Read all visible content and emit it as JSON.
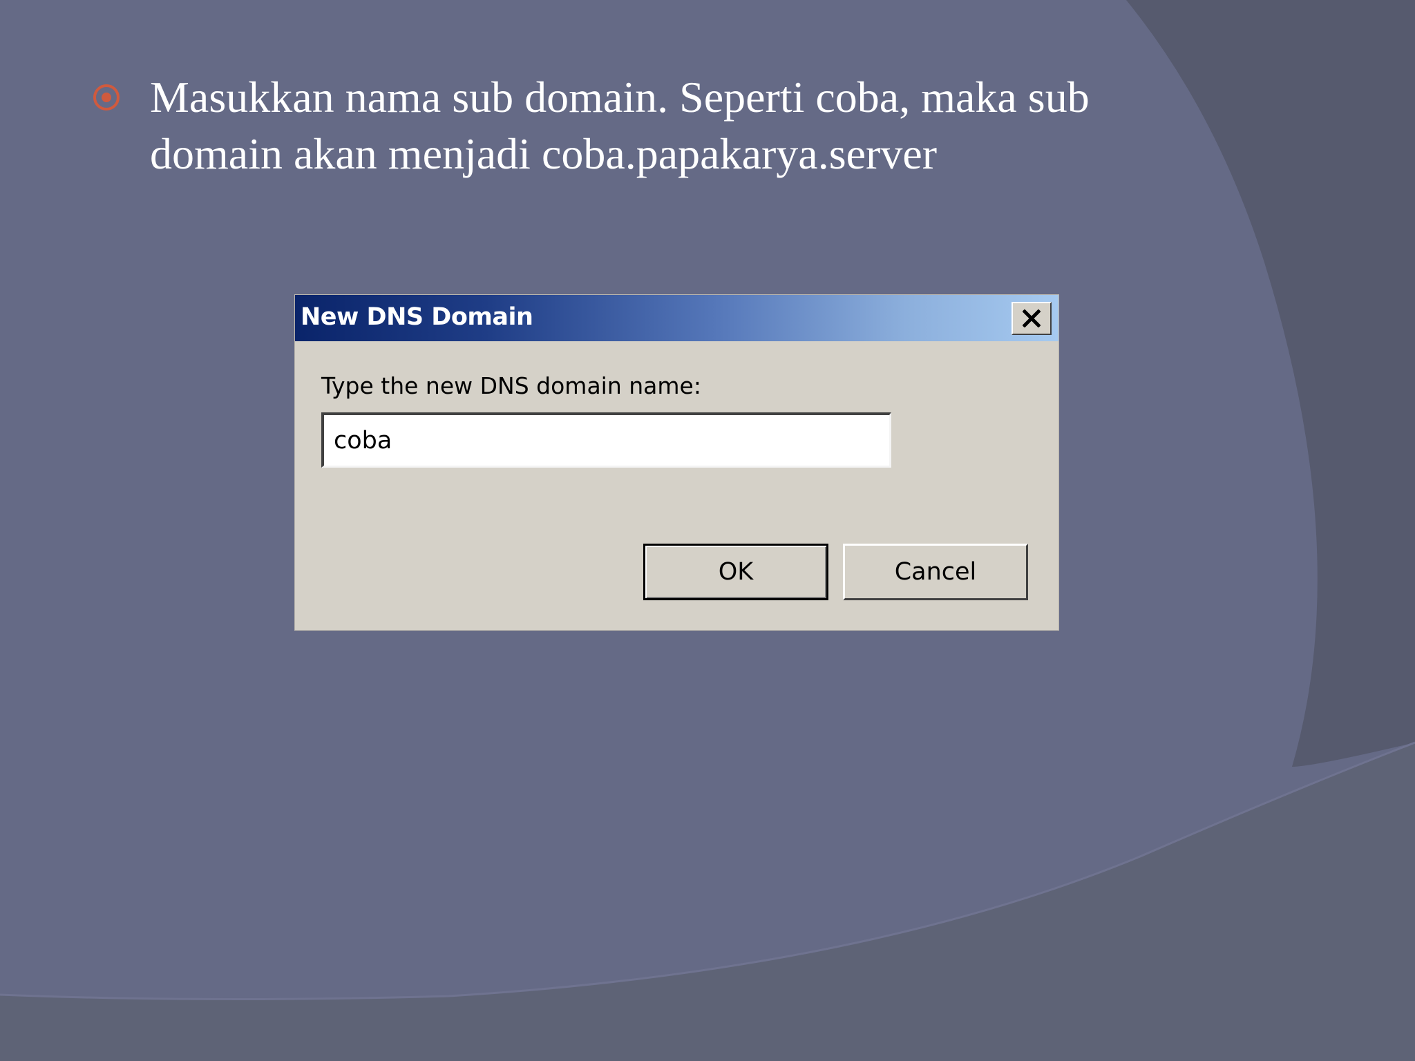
{
  "slide": {
    "bullet_text": "Masukkan nama sub domain. Seperti coba, maka sub domain akan menjadi coba.papakarya.server"
  },
  "dialog": {
    "title": "New DNS Domain",
    "prompt_label": "Type the new DNS domain name:",
    "input_value": "coba",
    "ok_label": "OK",
    "cancel_label": "Cancel"
  },
  "colors": {
    "slide_background": "#656a86",
    "bullet_accent": "#d05a3e",
    "titlebar_start": "#0a246a",
    "titlebar_end": "#a6caf0",
    "dialog_face": "#d5d1c8"
  }
}
